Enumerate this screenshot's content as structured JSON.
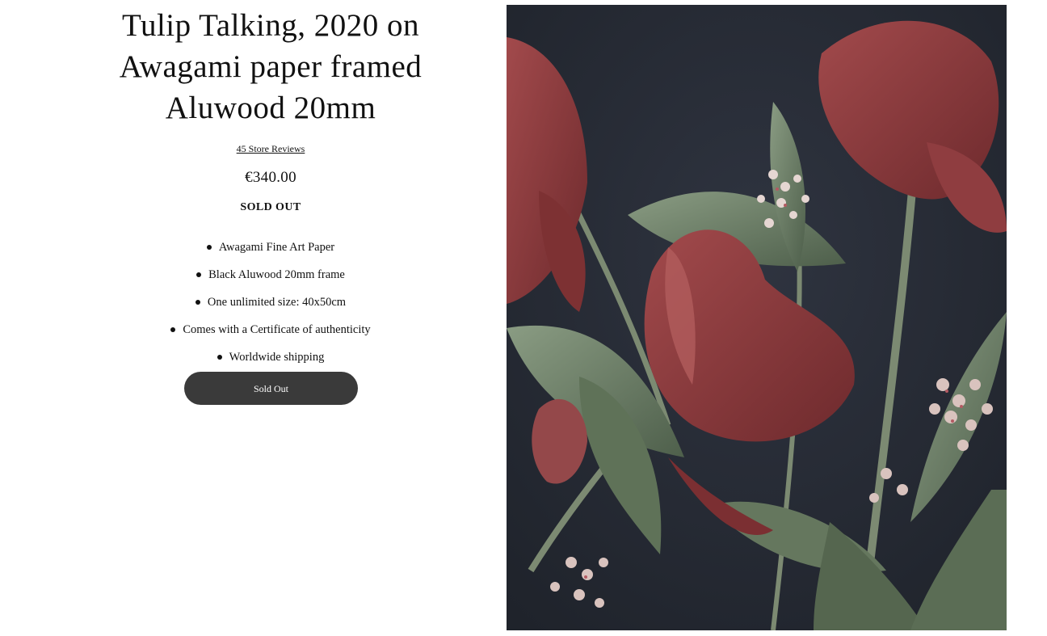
{
  "product": {
    "title": "Tulip Talking, 2020 on Awagami paper framed Aluwood 20mm",
    "reviews_link": "45 Store Reviews",
    "price": "€340.00",
    "availability": "SOLD OUT",
    "features": [
      "Awagami Fine Art Paper",
      "Black Aluwood 20mm frame",
      "One unlimited size: 40x50cm",
      "Comes with a Certificate of authenticity",
      "Worldwide shipping"
    ],
    "cta_label": "Sold Out"
  },
  "colors": {
    "button_bg": "#3a3a3a",
    "artwork_bg": "#262a33",
    "petal": "#8c3a3c",
    "leaf": "#6f8369"
  }
}
